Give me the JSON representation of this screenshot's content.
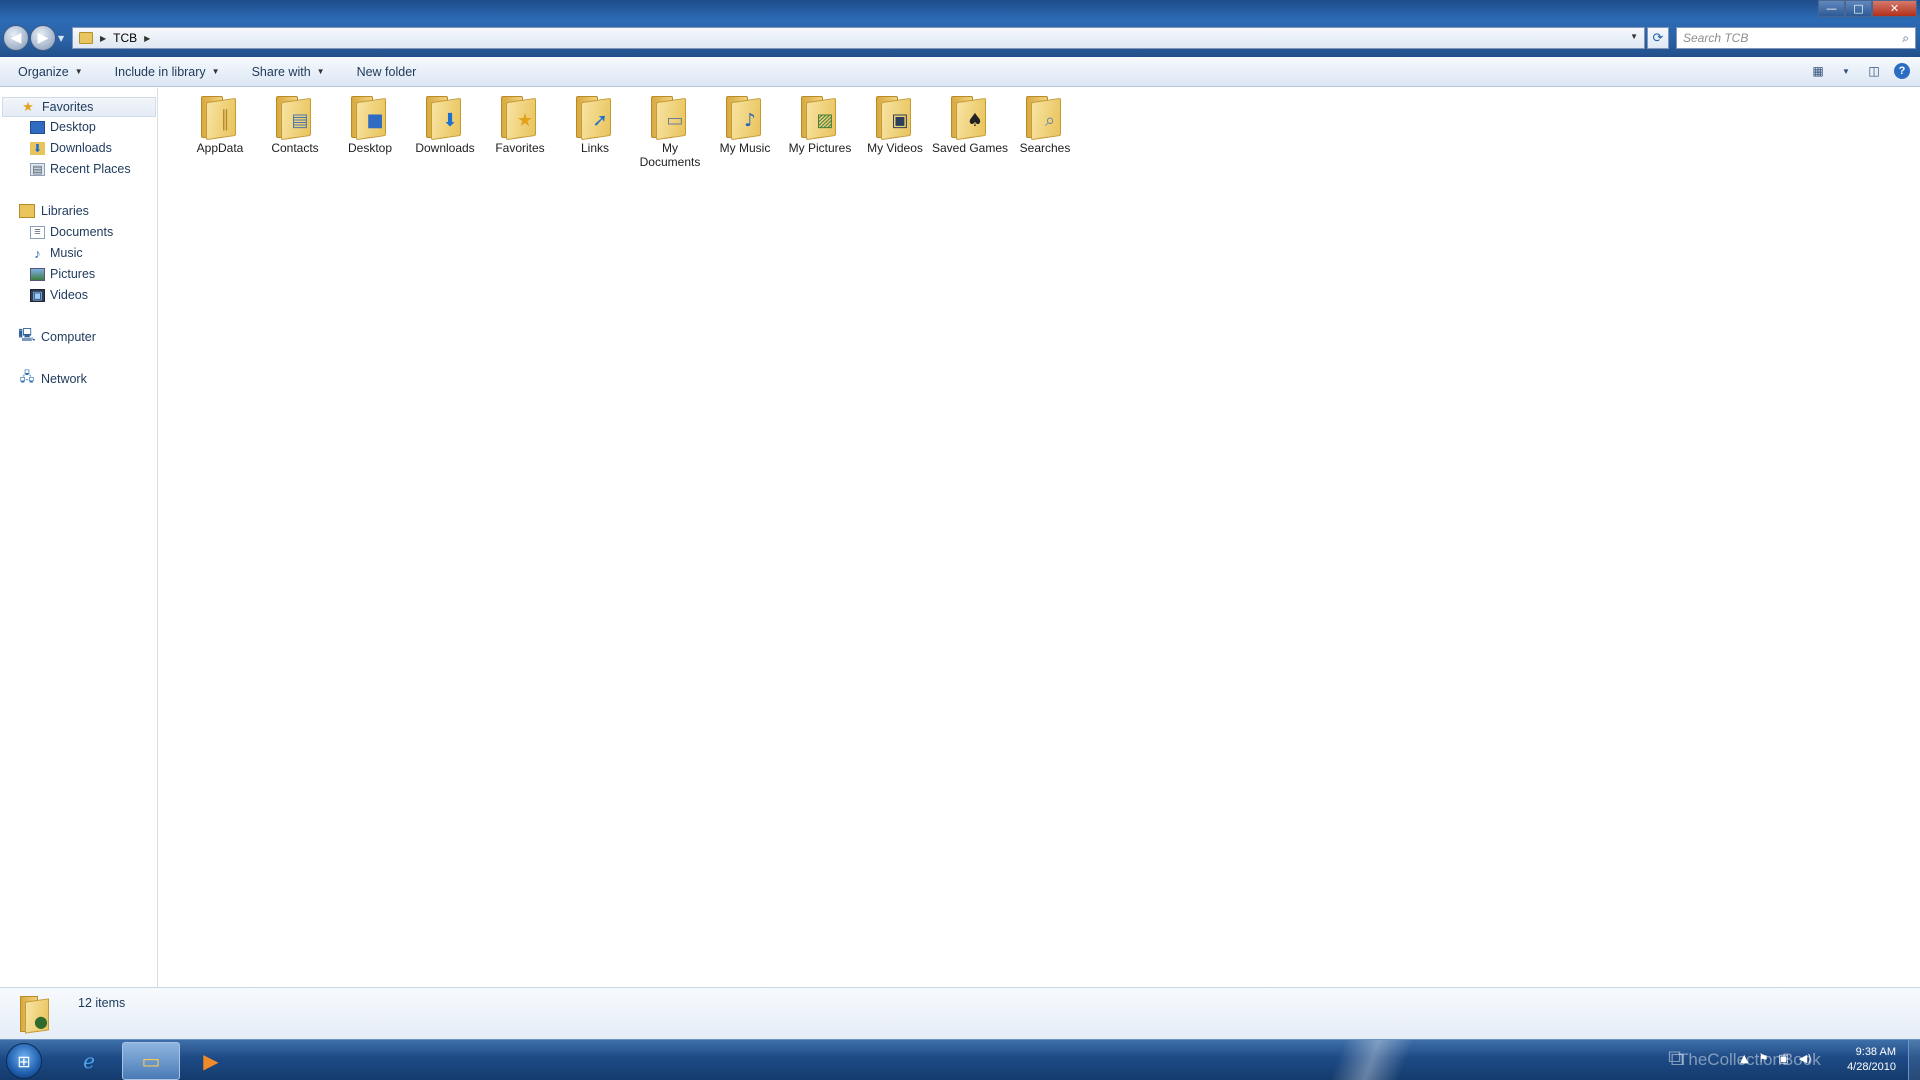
{
  "window": {
    "controls": {
      "minimize": "—",
      "maximize": "□",
      "close": "✕"
    }
  },
  "address": {
    "path": [
      "TCB"
    ],
    "search_placeholder": "Search TCB"
  },
  "toolbar": {
    "organize": "Organize",
    "include_in_library": "Include in library",
    "share_with": "Share with",
    "new_folder": "New folder"
  },
  "navpane": {
    "favorites": {
      "label": "Favorites",
      "items": [
        {
          "label": "Desktop",
          "icon": "desktop-icon"
        },
        {
          "label": "Downloads",
          "icon": "downloads-icon"
        },
        {
          "label": "Recent Places",
          "icon": "recent-places-icon"
        }
      ]
    },
    "libraries": {
      "label": "Libraries",
      "items": [
        {
          "label": "Documents",
          "icon": "documents-icon"
        },
        {
          "label": "Music",
          "icon": "music-icon"
        },
        {
          "label": "Pictures",
          "icon": "pictures-icon"
        },
        {
          "label": "Videos",
          "icon": "videos-icon"
        }
      ]
    },
    "computer": {
      "label": "Computer"
    },
    "network": {
      "label": "Network"
    }
  },
  "folders": [
    {
      "name": "AppData",
      "glyph": "appdata"
    },
    {
      "name": "Contacts",
      "glyph": "contacts"
    },
    {
      "name": "Desktop",
      "glyph": "desktop"
    },
    {
      "name": "Downloads",
      "glyph": "downloads"
    },
    {
      "name": "Favorites",
      "glyph": "favorites"
    },
    {
      "name": "Links",
      "glyph": "links"
    },
    {
      "name": "My Documents",
      "glyph": "documents"
    },
    {
      "name": "My Music",
      "glyph": "music"
    },
    {
      "name": "My Pictures",
      "glyph": "pictures"
    },
    {
      "name": "My Videos",
      "glyph": "videos"
    },
    {
      "name": "Saved Games",
      "glyph": "games"
    },
    {
      "name": "Searches",
      "glyph": "searches"
    }
  ],
  "details": {
    "item_count": "12 items"
  },
  "taskbar": {
    "watermark": "TheCollectionBook",
    "time": "9:38 AM",
    "date": "4/28/2010"
  },
  "colors": {
    "titlebar": "#2c6bb5",
    "folder": "#e9c45c",
    "taskbar": "#1d4a85"
  }
}
